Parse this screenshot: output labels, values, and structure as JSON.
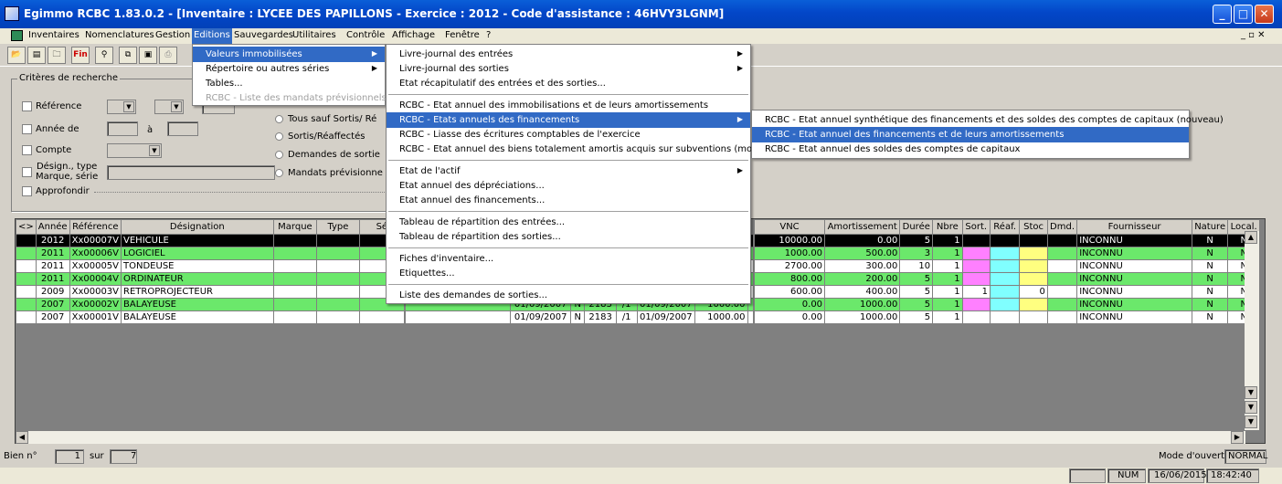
{
  "window": {
    "title": "Egimmo RCBC 1.83.0.2 - [Inventaire : LYCEE DES PAPILLONS - Exercice : 2012 - Code d'assistance : 46HVY3LGNM]"
  },
  "menubar": {
    "items": [
      "Inventaires",
      "Nomenclatures",
      "Gestion",
      "Editions",
      "Sauvegardes",
      "Utilitaires",
      "Contrôle",
      "Affichage",
      "Fenêtre",
      "?"
    ]
  },
  "toolbar": {
    "fin_label": "Fin"
  },
  "criteria": {
    "title": "Critères de recherche",
    "reference": "Référence",
    "annee_de": "Année de",
    "a": "à",
    "compte": "Compte",
    "design_type": "Désign., type",
    "marque_serie": "Marque, série",
    "approfondir": "Approfondir",
    "radio1": "Tous sauf Sortis/ Ré",
    "radio2": "Sortis/Réaffectés",
    "radio3": "Demandes de sortie",
    "radio4": "Mandats prévisionne"
  },
  "menu_editions": {
    "items": [
      "Valeurs immobilisées",
      "Répertoire ou autres séries",
      "Tables...",
      "RCBC - Liste des mandats prévisionnels"
    ]
  },
  "menu_valeurs": {
    "items": [
      "Livre-journal des entrées",
      "Livre-journal des sorties",
      "Etat récapitulatif des entrées et des sorties...",
      "RCBC - Etat annuel des immobilisations et de leurs amortissements",
      "RCBC - Etats annuels des financements",
      "RCBC - Liasse des écritures comptables de l'exercice",
      "RCBC - Etat annuel des biens totalement amortis acquis sur subventions (modifié)",
      "Etat de l'actif",
      "Etat annuel des dépréciations...",
      "Etat annuel des financements...",
      "Tableau de répartition des entrées...",
      "Tableau de répartition des sorties...",
      "Fiches d'inventaire...",
      "Etiquettes...",
      "Liste des demandes de sorties..."
    ]
  },
  "menu_financements": {
    "items": [
      "RCBC - Etat annuel synthétique des financements et des soldes des comptes de capitaux (nouveau)",
      "RCBC - Etat annuel des financements et de leurs amortissements",
      "RCBC - Etat annuel des soldes des comptes de capitaux"
    ]
  },
  "grid": {
    "left_headers": [
      "<>",
      "Année",
      "Référence",
      "Désignation",
      "Marque",
      "Type",
      "Sé"
    ],
    "right_headers": [
      "VNC",
      "Amortissement",
      "Durée",
      "Nbre",
      "Sort.",
      "Réaf.",
      "Stoc",
      "Dmd.",
      "Fournisseur",
      "Nature",
      "Local."
    ],
    "rows": [
      {
        "annee": "2012",
        "ref": "Xx00007V",
        "design": "VEHICULE",
        "mid": [
          "",
          "",
          "",
          "",
          "",
          ""
        ],
        "vnc": "10000.00",
        "amort": "0.00",
        "duree": "5",
        "nbre": "1",
        "sort": "",
        "stoc": "",
        "fourn": "INCONNU",
        "nature": "N",
        "local": "N"
      },
      {
        "annee": "2011",
        "ref": "Xx00006V",
        "design": "LOGICIEL",
        "mid": [
          "",
          "",
          "",
          "",
          "",
          ""
        ],
        "vnc": "1000.00",
        "amort": "500.00",
        "duree": "3",
        "nbre": "1",
        "sort": "",
        "stoc": "",
        "fourn": "INCONNU",
        "nature": "N",
        "local": "N"
      },
      {
        "annee": "2011",
        "ref": "Xx00005V",
        "design": "TONDEUSE",
        "mid": [
          "",
          "",
          "",
          "",
          "",
          ""
        ],
        "vnc": "2700.00",
        "amort": "300.00",
        "duree": "10",
        "nbre": "1",
        "sort": "",
        "stoc": "",
        "fourn": "INCONNU",
        "nature": "N",
        "local": "N"
      },
      {
        "annee": "2011",
        "ref": "Xx00004V",
        "design": "ORDINATEUR",
        "mid": [
          "",
          "",
          "",
          "",
          "",
          ""
        ],
        "vnc": "800.00",
        "amort": "200.00",
        "duree": "5",
        "nbre": "1",
        "sort": "",
        "stoc": "",
        "fourn": "INCONNU",
        "nature": "N",
        "local": "N"
      },
      {
        "annee": "2009",
        "ref": "Xx00003V",
        "design": "RETROPROJECTEUR",
        "mid": [
          "",
          "",
          "",
          "",
          "",
          ""
        ],
        "vnc": "600.00",
        "amort": "400.00",
        "duree": "5",
        "nbre": "1",
        "sort": "1",
        "stoc": "0",
        "fourn": "INCONNU",
        "nature": "N",
        "local": "N"
      },
      {
        "annee": "2007",
        "ref": "Xx00002V",
        "design": "BALAYEUSE",
        "mid": [
          "01/09/2007",
          "N",
          "2183",
          "/1",
          "01/09/2007",
          "1000.00"
        ],
        "vnc": "0.00",
        "amort": "1000.00",
        "duree": "5",
        "nbre": "1",
        "sort": "",
        "stoc": "",
        "fourn": "INCONNU",
        "nature": "N",
        "local": "N"
      },
      {
        "annee": "2007",
        "ref": "Xx00001V",
        "design": "BALAYEUSE",
        "mid": [
          "01/09/2007",
          "N",
          "2183",
          "/1",
          "01/09/2007",
          "1000.00"
        ],
        "vnc": "0.00",
        "amort": "1000.00",
        "duree": "5",
        "nbre": "1",
        "sort": "",
        "stoc": "",
        "fourn": "INCONNU",
        "nature": "N",
        "local": "N"
      }
    ]
  },
  "footer": {
    "bien_label": "Bien n°",
    "bien_value": "1",
    "sur_label": "sur",
    "sur_value": "7",
    "mode_label": "Mode d'ouverture",
    "mode_value": "NORMAL"
  },
  "statusbar": {
    "num": "NUM",
    "date": "16/06/2015",
    "time": "18:42:40"
  },
  "colors": {
    "selected_menu": "#316ac5",
    "row_green": "#6be86b",
    "flag_pink": "#ff80ff",
    "flag_cyan": "#80ffff",
    "flag_yellow": "#ffff80"
  }
}
